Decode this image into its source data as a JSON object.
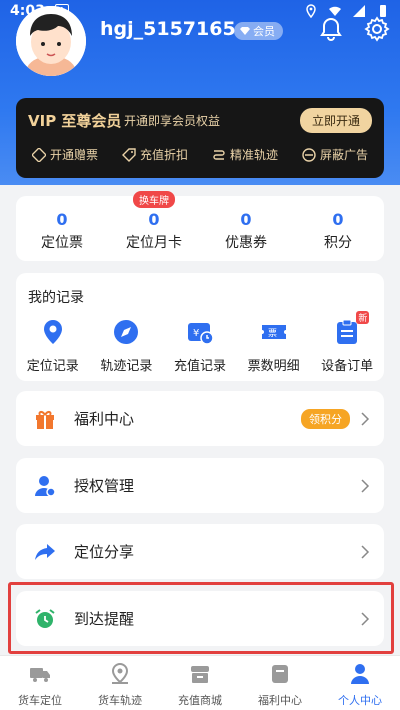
{
  "status_bar": {
    "time": "4:03",
    "a_icon": "A"
  },
  "profile": {
    "username": "hgj_5157165",
    "member_badge": "会员"
  },
  "vip": {
    "title": "VIP 至尊会员",
    "subtitle": "开通即享会员权益",
    "button": "立即开通",
    "features": [
      "开通赠票",
      "充值折扣",
      "精准轨迹",
      "屏蔽广告"
    ]
  },
  "stats": [
    {
      "value": "0",
      "label": "定位票"
    },
    {
      "value": "0",
      "label": "定位月卡",
      "tag": "换车牌"
    },
    {
      "value": "0",
      "label": "优惠券"
    },
    {
      "value": "0",
      "label": "积分"
    }
  ],
  "records": {
    "title": "我的记录",
    "items": [
      "定位记录",
      "轨迹记录",
      "充值记录",
      "票数明细",
      "设备订单"
    ],
    "new_badge": "新"
  },
  "menu": {
    "welfare": {
      "label": "福利中心",
      "pill": "领积分"
    },
    "auth": {
      "label": "授权管理"
    },
    "share": {
      "label": "定位分享"
    },
    "arrival": {
      "label": "到达提醒"
    }
  },
  "tabs": [
    "货车定位",
    "货车轨迹",
    "充值商城",
    "福利中心",
    "个人中心"
  ],
  "colors": {
    "primary": "#2f6ff0",
    "vip_gold": "#f1d4a0",
    "highlight": "#e2403e",
    "tag_red": "#f04848"
  }
}
